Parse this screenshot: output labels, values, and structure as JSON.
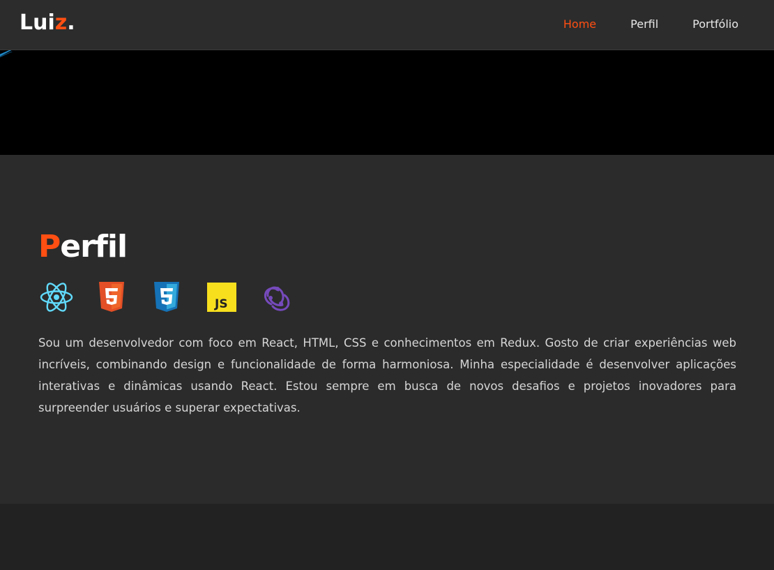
{
  "header": {
    "logo_main": "Lui",
    "logo_accent": "z",
    "logo_dot": ".",
    "nav": [
      {
        "label": "Home",
        "active": true
      },
      {
        "label": "Perfil",
        "active": false
      },
      {
        "label": "Portfólio",
        "active": false
      }
    ]
  },
  "profile": {
    "title_accent": "P",
    "title_rest": "erfil",
    "skills": [
      {
        "name": "react-icon",
        "color": "#61dafb"
      },
      {
        "name": "html5-icon",
        "color": "#e34f26"
      },
      {
        "name": "css3-icon",
        "color": "#1572b6"
      },
      {
        "name": "javascript-icon",
        "color": "#f7df1e",
        "label": "JS"
      },
      {
        "name": "redux-icon",
        "color": "#764abc"
      }
    ],
    "description": "Sou um desenvolvedor com foco em React, HTML, CSS e conhecimentos em Redux. Gosto de criar experiências web incríveis, combinando design e funcionalidade de forma harmoniosa. Minha especialidade é desenvolver aplicações interativas e dinâmicas usando React. Estou sempre em busca de novos desafios e projetos inovadores para surpreender usuários e superar expectativas."
  },
  "colors": {
    "accent": "#ff4f12",
    "header_bg": "#2c2c2c",
    "section_bg": "#2b2b2b",
    "page_bg": "#222222"
  }
}
